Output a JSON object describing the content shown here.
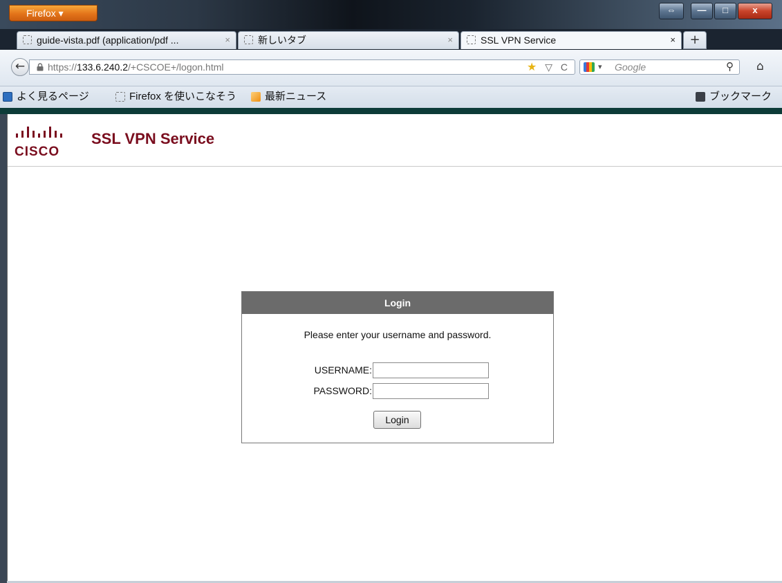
{
  "browser": {
    "app_button": "Firefox ▾",
    "window_buttons": {
      "restore": "⇔",
      "minimize": "—",
      "maximize": "□",
      "close": "x"
    },
    "tabs": [
      {
        "label": "guide-vista.pdf (application/pdf ...",
        "close": "×"
      },
      {
        "label": "新しいタブ",
        "close": "×"
      },
      {
        "label": "SSL VPN Service",
        "close": "×",
        "active": true
      }
    ],
    "new_tab": "+",
    "nav": {
      "back": "←",
      "url_scheme": "https://",
      "url_host": "133.6.240.2",
      "url_path": "/+CSCOE+/logon.html",
      "bookmark_star": "★",
      "dropdown": "▽",
      "reload": "C",
      "search_placeholder": "Google",
      "search_caret": "▾",
      "search_go": "⚲",
      "home": "⌂"
    },
    "bookmarks": [
      "よく見るページ",
      "Firefox を使いこなそう",
      "最新ニュース"
    ],
    "bookmarks_menu": "ブックマーク"
  },
  "page": {
    "logo_word": "CISCO",
    "title": "SSL VPN Service",
    "login": {
      "heading": "Login",
      "message": "Please enter your username and password.",
      "username_label": "USERNAME:",
      "username_value": "",
      "password_label": "PASSWORD:",
      "password_value": "",
      "submit_label": "Login"
    }
  },
  "colors": {
    "brand_red": "#7a0d1e",
    "login_header": "#6b6b6b",
    "firefox_orange": "#e3741a"
  }
}
